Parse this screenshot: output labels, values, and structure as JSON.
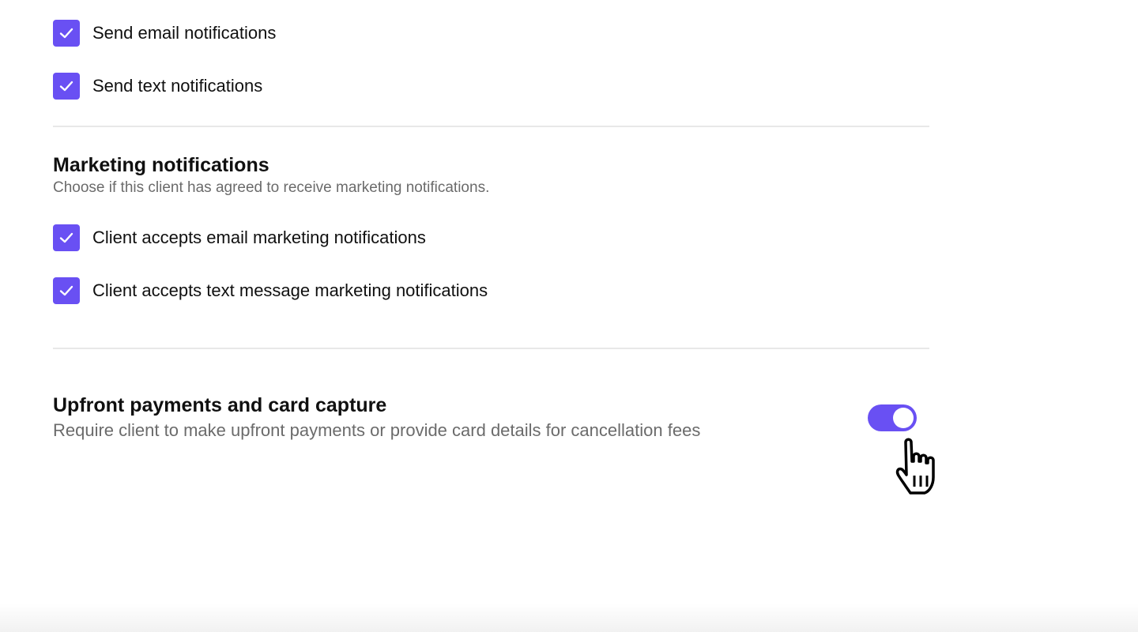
{
  "transactional": {
    "items": [
      {
        "label": "Send email notifications",
        "checked": true
      },
      {
        "label": "Send text notifications",
        "checked": true
      }
    ]
  },
  "marketing": {
    "title": "Marketing notifications",
    "description": "Choose if this client has agreed to receive marketing notifications.",
    "items": [
      {
        "label": "Client accepts email marketing notifications",
        "checked": true
      },
      {
        "label": "Client accepts text message marketing notifications",
        "checked": true
      }
    ]
  },
  "upfront": {
    "title": "Upfront payments and card capture",
    "description": "Require client to make upfront payments or provide card details for cancellation fees",
    "toggle_on": true
  },
  "colors": {
    "accent": "#6950f3",
    "text": "#101010",
    "muted": "#6b6b6b",
    "divider": "#e8e8e8"
  },
  "icons": {
    "checkbox": "checkmark-icon",
    "cursor": "hand-pointer-cursor-icon"
  }
}
